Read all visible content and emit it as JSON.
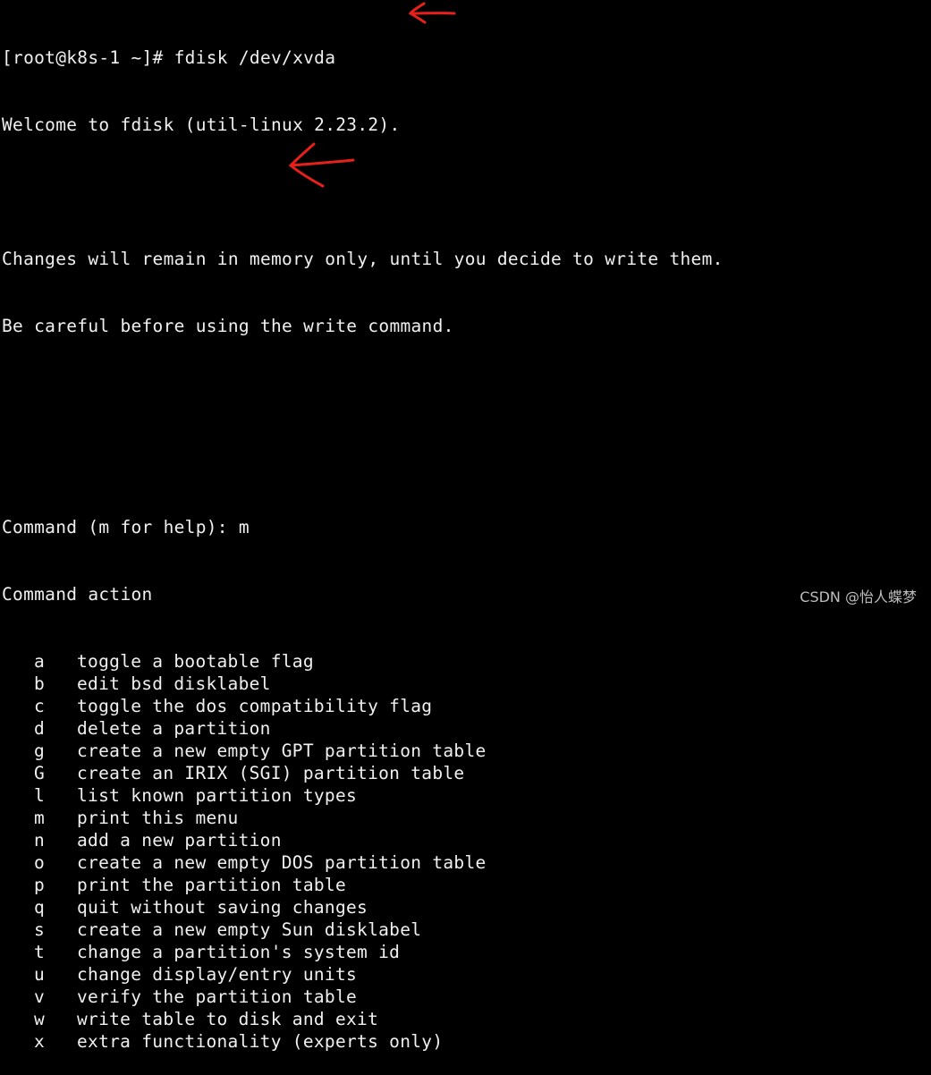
{
  "terminal": {
    "prompt_line": "[root@k8s-1 ~]# fdisk /dev/xvda",
    "welcome": "Welcome to fdisk (util-linux 2.23.2).",
    "blank1": "",
    "changes_notice": "Changes will remain in memory only, until you decide to write them.",
    "careful_notice": "Be careful before using the write command.",
    "blank2": "",
    "blank3": "",
    "command_prompt": "Command (m for help): m",
    "command_action": "Command action",
    "menu": [
      {
        "key": "a",
        "desc": "toggle a bootable flag"
      },
      {
        "key": "b",
        "desc": "edit bsd disklabel"
      },
      {
        "key": "c",
        "desc": "toggle the dos compatibility flag"
      },
      {
        "key": "d",
        "desc": "delete a partition"
      },
      {
        "key": "g",
        "desc": "create a new empty GPT partition table"
      },
      {
        "key": "G",
        "desc": "create an IRIX (SGI) partition table"
      },
      {
        "key": "l",
        "desc": "list known partition types"
      },
      {
        "key": "m",
        "desc": "print this menu"
      },
      {
        "key": "n",
        "desc": "add a new partition"
      },
      {
        "key": "o",
        "desc": "create a new empty DOS partition table"
      },
      {
        "key": "p",
        "desc": "print the partition table"
      },
      {
        "key": "q",
        "desc": "quit without saving changes"
      },
      {
        "key": "s",
        "desc": "create a new empty Sun disklabel"
      },
      {
        "key": "t",
        "desc": "change a partition's system id"
      },
      {
        "key": "u",
        "desc": "change display/entry units"
      },
      {
        "key": "v",
        "desc": "verify the partition table"
      },
      {
        "key": "w",
        "desc": "write table to disk and exit"
      },
      {
        "key": "x",
        "desc": "extra functionality (experts only)"
      }
    ]
  },
  "annotations": {
    "arrow_color": "#e8201c"
  },
  "watermark": "CSDN @怡人蝶梦"
}
